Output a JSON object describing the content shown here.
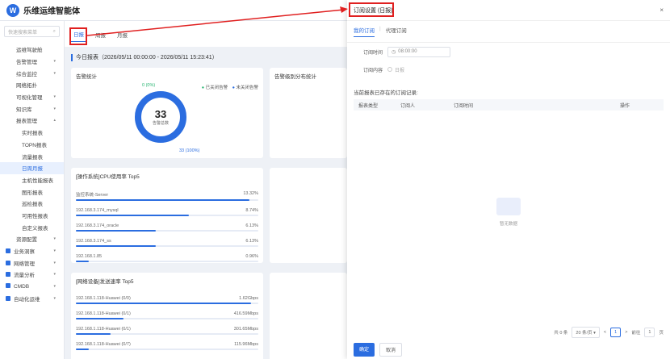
{
  "app": {
    "title": "乐维运维智能体",
    "logo": "W"
  },
  "sidebar": {
    "search_placeholder": "快速搜索菜单",
    "items": [
      {
        "label": "运维驾驶舱",
        "level": "sub1",
        "chev": ""
      },
      {
        "label": "告警管理",
        "level": "sub1",
        "chev": "▾"
      },
      {
        "label": "综合监控",
        "level": "sub1",
        "chev": "▾"
      },
      {
        "label": "网络拓扑",
        "level": "sub1",
        "chev": ""
      },
      {
        "label": "可视化管理",
        "level": "sub1",
        "chev": "▾"
      },
      {
        "label": "知识库",
        "level": "sub1",
        "chev": "▾"
      },
      {
        "label": "报表管理",
        "level": "sub1",
        "chev": "▴"
      },
      {
        "label": "实时报表",
        "level": "sub2",
        "chev": ""
      },
      {
        "label": "TOPN报表",
        "level": "sub2",
        "chev": ""
      },
      {
        "label": "流量报表",
        "level": "sub2",
        "chev": ""
      },
      {
        "label": "日周月报",
        "level": "sub2",
        "chev": "",
        "active": true
      },
      {
        "label": "主机性能报表",
        "level": "sub2",
        "chev": ""
      },
      {
        "label": "图形报表",
        "level": "sub2",
        "chev": ""
      },
      {
        "label": "巡检报表",
        "level": "sub2",
        "chev": ""
      },
      {
        "label": "可用性报表",
        "level": "sub2",
        "chev": ""
      },
      {
        "label": "自定义报表",
        "level": "sub2",
        "chev": ""
      },
      {
        "label": "资源配置",
        "level": "sub1",
        "chev": "▾"
      },
      {
        "label": "业务洞察",
        "level": "top",
        "chev": "▾"
      },
      {
        "label": "网络管理",
        "level": "top",
        "chev": "▾"
      },
      {
        "label": "流量分析",
        "level": "top",
        "chev": "▾"
      },
      {
        "label": "CMDB",
        "level": "top",
        "chev": "▾"
      },
      {
        "label": "自动化运维",
        "level": "top",
        "chev": "▾"
      }
    ]
  },
  "tabs": [
    {
      "label": "日报",
      "active": true
    },
    {
      "label": "周报",
      "active": false
    },
    {
      "label": "月报",
      "active": false
    }
  ],
  "report": {
    "title": "今日报表（2026/05/11 00:00:00 - 2026/05/11 15:23:41）"
  },
  "alarm_card": {
    "title": "告警统计",
    "legend_closed": "已关闭告警",
    "legend_open": "未关闭告警",
    "total": "33",
    "total_label": "告警总数",
    "top_label": "0 (0%)",
    "bottom_label": "33 (100%)",
    "open_fraction": 1.0,
    "color_closed": "#2bb673",
    "color_open": "#2b6de0"
  },
  "cpu_card": {
    "title": "[操作系统]CPU使用率 Top5",
    "rows": [
      {
        "name": "监控系统-Server",
        "value": "13.32%",
        "fraction": 0.95
      },
      {
        "name": "192.168.3.174_mysql",
        "value": "8.74%",
        "fraction": 0.62
      },
      {
        "name": "192.168.3.174_oracle",
        "value": "6.13%",
        "fraction": 0.44
      },
      {
        "name": "192.168.3.174_ss",
        "value": "6.13%",
        "fraction": 0.44
      },
      {
        "name": "192.168.1.85",
        "value": "0.96%",
        "fraction": 0.07
      }
    ]
  },
  "net_card": {
    "title": "[网络设备]发送速率 Top5",
    "rows": [
      {
        "name": "192.168.1.118-Huawei (0/0)",
        "value": "1.62Gbps",
        "fraction": 0.96
      },
      {
        "name": "192.168.1.118-Huawei (0/1)",
        "value": "416.59Mbps",
        "fraction": 0.26
      },
      {
        "name": "192.168.1.118-Huawei (0/1)",
        "value": "301.65Mbps",
        "fraction": 0.19
      },
      {
        "name": "192.168.1.118-Huawei (0/7)",
        "value": "115.96Mbps",
        "fraction": 0.07
      }
    ]
  },
  "dialog": {
    "title": "订阅设置 (日报)",
    "close": "×",
    "tabs": [
      {
        "label": "我的订阅",
        "active": true
      },
      {
        "label": "代理订阅",
        "active": false
      }
    ],
    "time_label": "订阅时间",
    "time_value": "08:00:00",
    "content_label": "订阅内容",
    "content_option": "日报",
    "list_caption": "当前报表已存在的订阅记录:",
    "table_headers": [
      "报表类型",
      "订阅人",
      "订阅时间",
      "操作"
    ],
    "empty_text": "暂无数据",
    "pager": {
      "total": "共 0 条",
      "page_size": "20 条/页",
      "prev": "<",
      "current": "1",
      "next": ">",
      "goto_label": "前往",
      "goto_value": "1",
      "page_unit": "页"
    },
    "confirm": "确定",
    "cancel": "取消"
  }
}
